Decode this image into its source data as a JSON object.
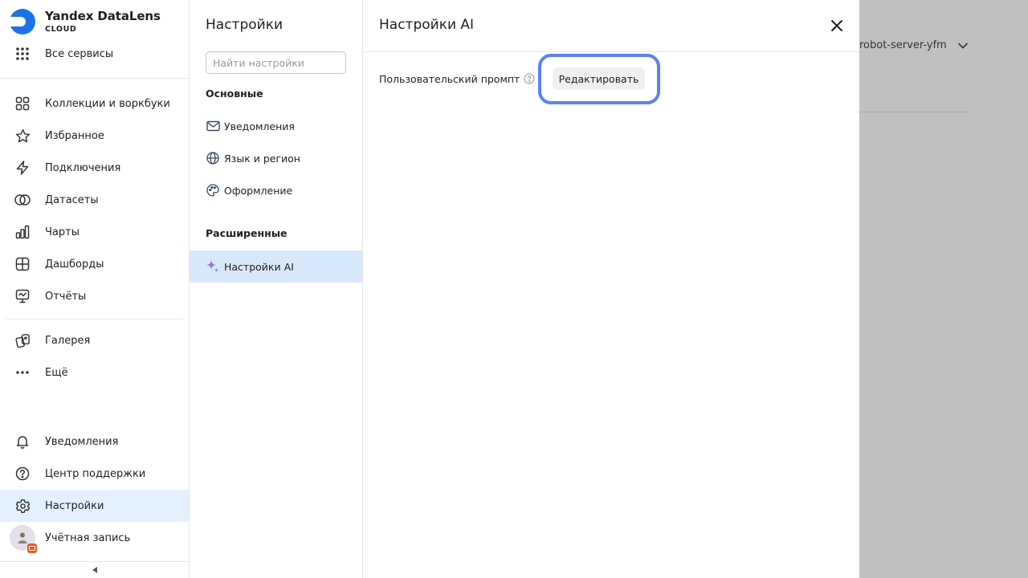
{
  "brand": {
    "name": "Yandex DataLens",
    "subtitle": "CLOUD",
    "accent_color": "#1a73e8"
  },
  "nav": {
    "all_services": "Все сервисы",
    "items": [
      {
        "label": "Коллекции и воркбуки",
        "icon": "grid-icon"
      },
      {
        "label": "Избранное",
        "icon": "star-icon"
      },
      {
        "label": "Подключения",
        "icon": "bolt-icon"
      },
      {
        "label": "Датасеты",
        "icon": "rings-icon"
      },
      {
        "label": "Чарты",
        "icon": "chart-icon"
      },
      {
        "label": "Дашборды",
        "icon": "dashboard-icon"
      },
      {
        "label": "Отчёты",
        "icon": "report-icon"
      }
    ],
    "gallery": "Галерея",
    "more": "Ещё",
    "notifications": "Уведомления",
    "support": "Центр поддержки",
    "settings": "Настройки",
    "account": "Учётная запись",
    "active_item": "Настройки",
    "active_color": "#e3f0fe"
  },
  "background": {
    "user_name": "robot-server-yfm",
    "overlay_color": "#c0c0c0"
  },
  "settings": {
    "title": "Настройки",
    "search_placeholder": "Найти настройки",
    "groups": {
      "basic": {
        "title": "Основные",
        "items": [
          {
            "label": "Уведомления",
            "icon": "mail-icon"
          },
          {
            "label": "Язык и регион",
            "icon": "globe-icon"
          },
          {
            "label": "Оформление",
            "icon": "palette-icon"
          }
        ]
      },
      "advanced": {
        "title": "Расширенные",
        "items": [
          {
            "label": "Настройки AI",
            "icon": "sparkle-icon",
            "active": true
          }
        ]
      }
    }
  },
  "panel": {
    "title": "Настройки AI",
    "field_label": "Пользовательский промпт",
    "edit_button": "Редактировать",
    "highlight_color": "#5b82f2"
  }
}
